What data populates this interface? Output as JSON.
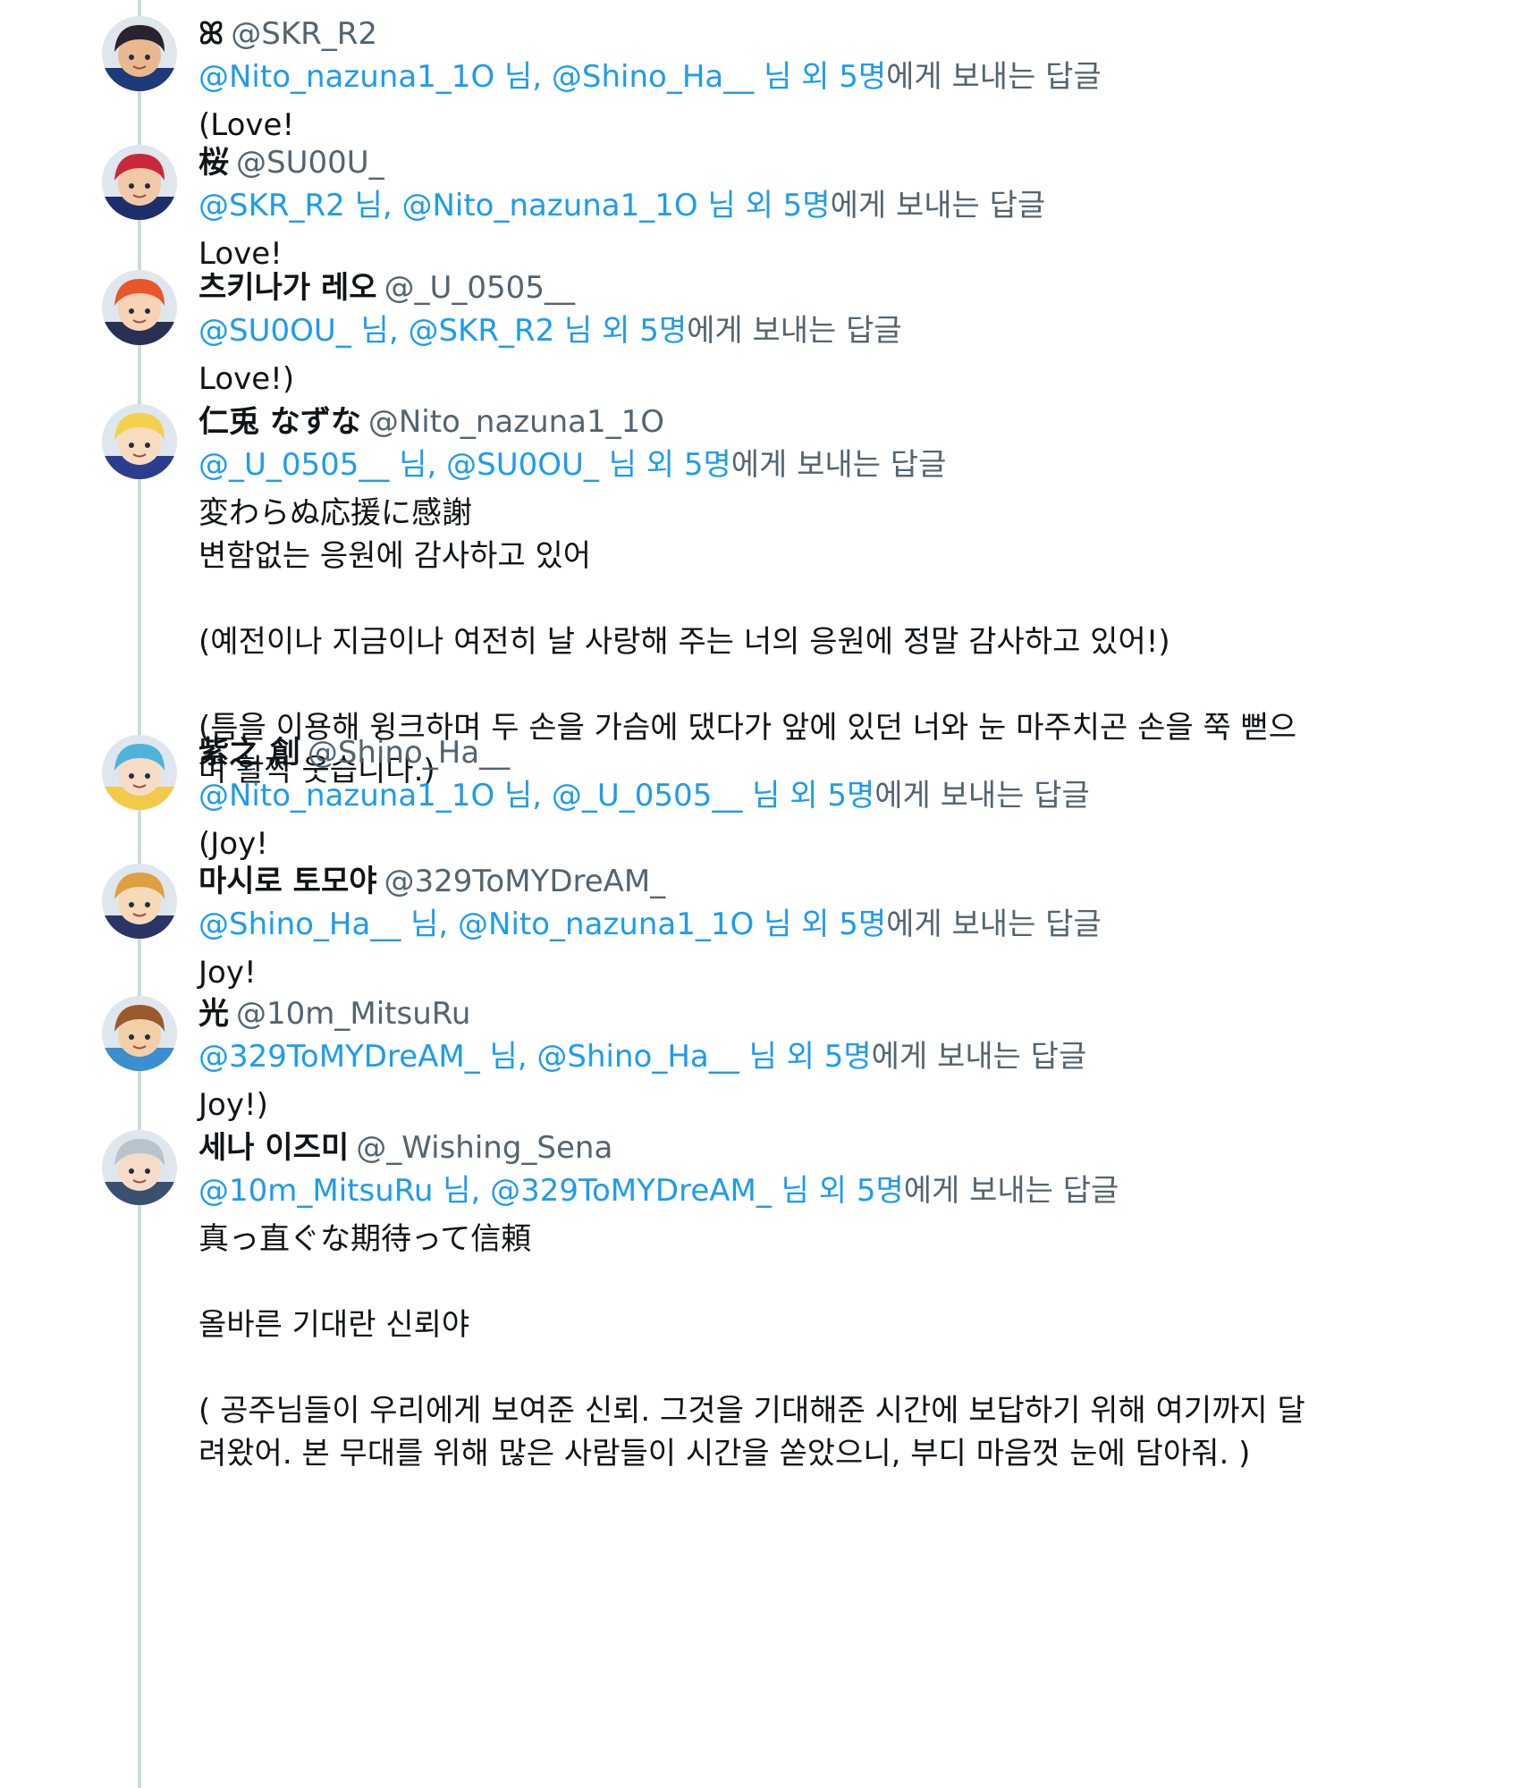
{
  "colors": {
    "link": "#1d9bf0",
    "secondary_text": "#536471",
    "thread_line": "#cfd9de",
    "text": "#0f1419"
  },
  "reply_suffix": "님 외 5명",
  "reply_label": "에게 보내는 답글",
  "tweets": [
    {
      "display_name": "ꕤ",
      "handle": "@SKR_R2",
      "reply_to_1": "@Nito_nazuna1_1O",
      "reply_to_2": "@Shino_Ha__",
      "text": "(Love!",
      "avatar": "avatar-dark-hair-boy",
      "avatar_colors": [
        "#2b2230",
        "#e8b98f",
        "#1f3a7a"
      ]
    },
    {
      "display_name": "桜",
      "handle": "@SU00U_",
      "reply_to_1": "@SKR_R2",
      "reply_to_2": "@Nito_nazuna1_1O",
      "text": "Love!",
      "avatar": "avatar-red-hair-boy",
      "avatar_colors": [
        "#c8283a",
        "#f2c9a8",
        "#1d2f6b"
      ]
    },
    {
      "display_name": "츠키나가 레오",
      "handle": "@_U_0505__",
      "reply_to_1": "@SU0OU_",
      "reply_to_2": "@SKR_R2",
      "text": "Love!)",
      "avatar": "avatar-orange-hair-boy",
      "avatar_colors": [
        "#e8562a",
        "#f6d3b4",
        "#2a2f55"
      ]
    },
    {
      "display_name": "仁兎 なずな",
      "handle": "@Nito_nazuna1_1O",
      "reply_to_1": "@_U_0505__",
      "reply_to_2": "@SU0OU_",
      "text": "変わらぬ応援に感謝\n변함없는 응원에 감사하고 있어\n\n(예전이나 지금이나 여전히 날 사랑해 주는 너의 응원에 정말 감사하고 있어!)\n\n(틈을 이용해 윙크하며 두 손을 가슴에 댔다가 앞에 있던 너와 눈 마주치곤 손을 쭉 뻗으며 활짝 웃습니다.)",
      "avatar": "avatar-blond-hair-boy",
      "avatar_colors": [
        "#f2d24a",
        "#f8dcc0",
        "#2b3d8f"
      ]
    },
    {
      "display_name": "紫之 創",
      "handle": "@Shino_Ha__",
      "reply_to_1": "@Nito_nazuna1_1O",
      "reply_to_2": "@_U_0505__",
      "text": "(Joy!",
      "avatar": "avatar-teal-hair-boy",
      "avatar_colors": [
        "#4fb3d9",
        "#f6dcc6",
        "#f3c94a"
      ]
    },
    {
      "display_name": "마시로 토모야",
      "handle": "@329ToMYDreAM_",
      "reply_to_1": "@Shino_Ha__",
      "reply_to_2": "@Nito_nazuna1_1O",
      "text": "Joy!",
      "avatar": "avatar-ginger-hair-boy",
      "avatar_colors": [
        "#e0a040",
        "#f6d9b8",
        "#2a3566"
      ]
    },
    {
      "display_name": "光",
      "handle": "@10m_MitsuRu",
      "reply_to_1": "@329ToMYDreAM_",
      "reply_to_2": "@Shino_Ha__",
      "text": "Joy!)",
      "avatar": "avatar-brown-hair-boy",
      "avatar_colors": [
        "#9a5a2a",
        "#f3cfa8",
        "#3a8fd0"
      ]
    },
    {
      "display_name": "세나 이즈미",
      "handle": "@_Wishing_Sena",
      "reply_to_1": "@10m_MitsuRu",
      "reply_to_2": "@329ToMYDreAM_",
      "text": "真っ直ぐな期待って信頼\n\n올바른 기대란 신뢰야\n\n( 공주님들이 우리에게 보여준 신뢰. 그것을 기대해준 시간에 보답하기 위해 여기까지 달려왔어. 본 무대를 위해 많은 사람들이 시간을 쏟았으니, 부디 마음껏 눈에 담아줘. )",
      "avatar": "avatar-silver-hair-boy",
      "avatar_colors": [
        "#b8c4cc",
        "#f6dcc6",
        "#3a5070"
      ]
    }
  ]
}
